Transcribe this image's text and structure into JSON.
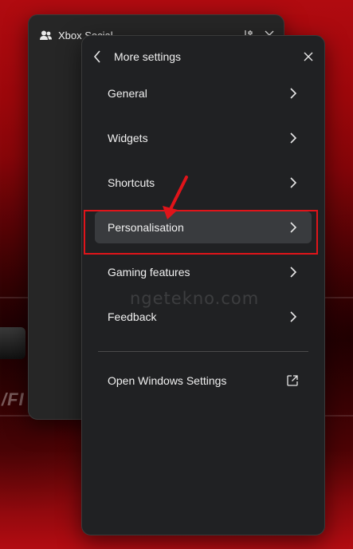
{
  "background_panel": {
    "title": "Xbox Social"
  },
  "more_settings": {
    "title": "More settings",
    "items": [
      {
        "label": "General"
      },
      {
        "label": "Widgets"
      },
      {
        "label": "Shortcuts"
      },
      {
        "label": "Personalisation",
        "selected": true
      },
      {
        "label": "Gaming features"
      },
      {
        "label": "Feedback"
      }
    ],
    "open_windows_settings": "Open Windows Settings"
  },
  "annotation": {
    "highlight_color": "#e0141a",
    "watermark": "ngetekno.com"
  },
  "colors": {
    "panel_bg": "#202123",
    "selected_item_bg": "#393b3e",
    "text": "#f1f1f1"
  },
  "icons": {
    "back": "chevron-left-icon",
    "close": "close-icon",
    "item_arrow": "chevron-right-icon",
    "external": "open-external-icon",
    "social": "people-icon",
    "filter": "tune-icon"
  }
}
